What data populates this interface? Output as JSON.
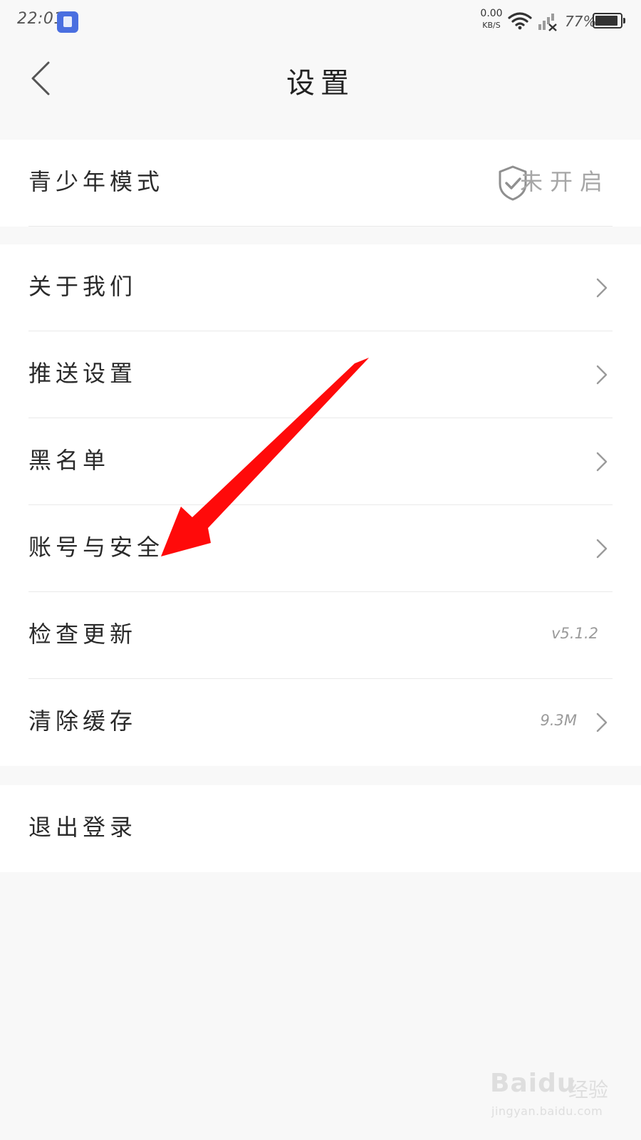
{
  "status_bar": {
    "time": "22:01",
    "net_speed_value": "0.00",
    "net_speed_unit": "KB/S",
    "battery_percent": "77%",
    "icons": [
      "app-notification-icon",
      "wifi-icon",
      "cellular-signal-no-service-icon",
      "battery-icon"
    ]
  },
  "nav": {
    "title": "设置",
    "back_icon": "chevron-left-icon"
  },
  "youth_mode": {
    "label": "青少年模式",
    "status": "未开启",
    "icon": "shield-check-icon"
  },
  "menu": {
    "items": [
      {
        "label": "关于我们",
        "value": "",
        "chevron": true
      },
      {
        "label": "推送设置",
        "value": "",
        "chevron": true
      },
      {
        "label": "黑名单",
        "value": "",
        "chevron": true
      },
      {
        "label": "账号与安全",
        "value": "",
        "chevron": true
      },
      {
        "label": "检查更新",
        "value": "v5.1.2",
        "chevron": false
      },
      {
        "label": "清除缓存",
        "value": "9.3M",
        "chevron": true
      }
    ]
  },
  "logout": {
    "label": "退出登录"
  },
  "watermark": {
    "brand": "Baidu",
    "brand_cn": "经验",
    "url": "jingyan.baidu.com"
  },
  "colors": {
    "background": "#f8f8f8",
    "card": "#ffffff",
    "divider": "#e9e9e9",
    "text_primary": "#2a2a2a",
    "text_secondary": "#9a9a9a",
    "annotation_arrow": "#ff0a0a"
  }
}
